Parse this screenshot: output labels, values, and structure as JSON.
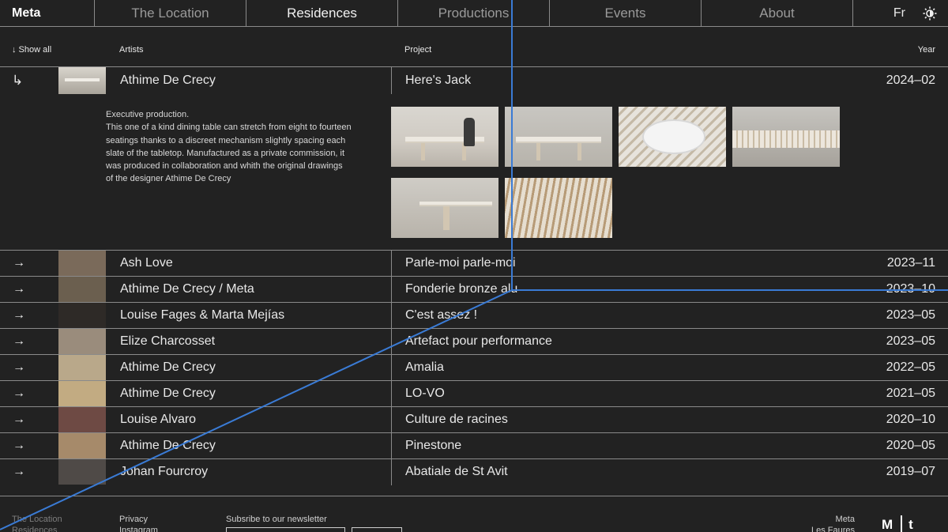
{
  "nav": {
    "logo": "Meta",
    "items": [
      "The Location",
      "Residences",
      "Productions",
      "Events",
      "About"
    ],
    "active_index": 1,
    "lang": "Fr"
  },
  "table": {
    "show_all": "↓ Show all",
    "col_artists": "Artists",
    "col_project": "Project",
    "col_year": "Year"
  },
  "expanded": {
    "arrow": "↳",
    "artist": "Athime De Crecy",
    "project": "Here's Jack",
    "year": "2024–02",
    "description": [
      "Executive production.",
      "This one of a kind dining table can stretch from eight to fourteen",
      "seatings thanks to a discreet mechanism slightly spacing each",
      "slate of the tabletop. Manufactured as a private commission, it",
      "was produced in collaboration and whith the original drawings",
      "of the designer Athime De Crecy"
    ]
  },
  "rows": [
    {
      "arrow": "→",
      "artist": "Ash Love",
      "project": "Parle-moi parle-moi",
      "year": "2023–11",
      "thumb_color": "#7a6a5a"
    },
    {
      "arrow": "→",
      "artist": "Athime De Crecy / Meta",
      "project": "Fonderie bronze alu",
      "year": "2023–10",
      "thumb_color": "#6b5f4f"
    },
    {
      "arrow": "→",
      "artist": "Louise Fages & Marta Mejías",
      "project": "C'est assez !",
      "year": "2023–05",
      "thumb_color": "#2e2a27"
    },
    {
      "arrow": "→",
      "artist": "Elize Charcosset",
      "project": "Artefact pour performance",
      "year": "2023–05",
      "thumb_color": "#9a8c7c"
    },
    {
      "arrow": "→",
      "artist": "Athime De Crecy",
      "project": "Amalia",
      "year": "2022–05",
      "thumb_color": "#b9a88a"
    },
    {
      "arrow": "→",
      "artist": "Athime De Crecy",
      "project": "LO-VO",
      "year": "2021–05",
      "thumb_color": "#c2ab82"
    },
    {
      "arrow": "→",
      "artist": "Louise Alvaro",
      "project": "Culture de racines",
      "year": "2020–10",
      "thumb_color": "#6e4a44"
    },
    {
      "arrow": "→",
      "artist": "Athime De Crecy",
      "project": "Pinestone",
      "year": "2020–05",
      "thumb_color": "#a68a6a"
    },
    {
      "arrow": "→",
      "artist": "Johan Fourcroy",
      "project": "Abatiale de St Avit",
      "year": "2019–07",
      "thumb_color": "#4f4a47"
    }
  ],
  "footer": {
    "col1": [
      "The Location",
      "Residences"
    ],
    "col2": [
      "Privacy",
      "Instagram"
    ],
    "newsletter": "Subsribe to our newsletter",
    "address": [
      "Meta",
      "Les Faures"
    ],
    "mark": "Mt"
  },
  "colors": {
    "background": "#222222",
    "line": "#8a8a8a",
    "overlay_line": "#3a7bd5"
  }
}
